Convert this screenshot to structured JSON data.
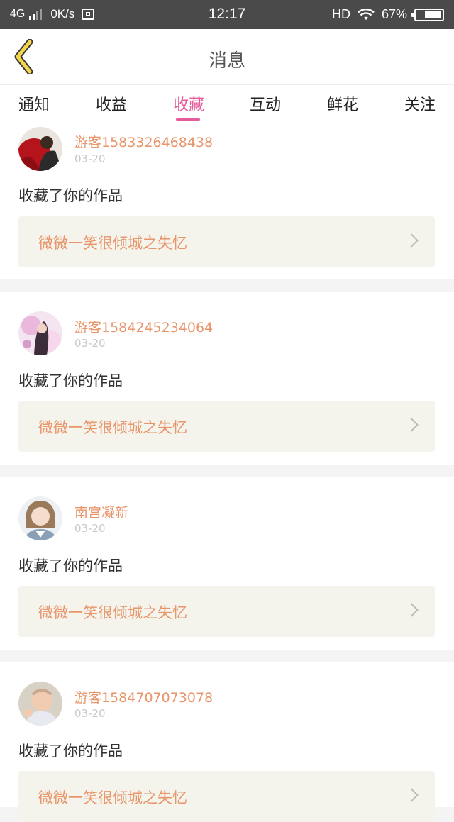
{
  "status": {
    "network": "4G",
    "speed": "0K/s",
    "time": "12:17",
    "hd": "HD",
    "battery_percent": "67%",
    "battery_level": 0.67
  },
  "header": {
    "title": "消息"
  },
  "tabs": [
    {
      "label": "通知"
    },
    {
      "label": "收益"
    },
    {
      "label": "收藏",
      "active": true
    },
    {
      "label": "互动"
    },
    {
      "label": "鲜花"
    },
    {
      "label": "关注"
    }
  ],
  "messages": [
    {
      "user": "游客1583326468438",
      "date": "03-20",
      "action": "收藏了你的作品",
      "work": "微微一笑很倾城之失忆"
    },
    {
      "user": "游客1584245234064",
      "date": "03-20",
      "action": "收藏了你的作品",
      "work": "微微一笑很倾城之失忆"
    },
    {
      "user": "南宫凝新",
      "date": "03-20",
      "action": "收藏了你的作品",
      "work": "微微一笑很倾城之失忆"
    },
    {
      "user": "游客1584707073078",
      "date": "03-20",
      "action": "收藏了你的作品",
      "work": "微微一笑很倾城之失忆"
    }
  ],
  "colors": {
    "accent_tab": "#e45a9a",
    "username": "#e8956a",
    "work_title": "#e8956a",
    "back_arrow": "#f3d64a"
  }
}
